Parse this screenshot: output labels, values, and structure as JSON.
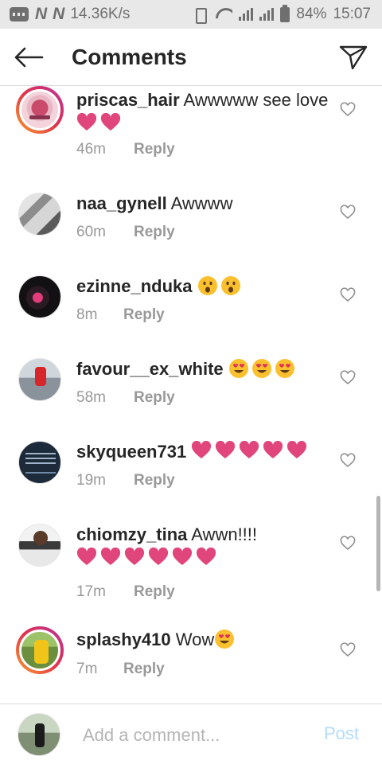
{
  "status_bar": {
    "network_letters": [
      "N",
      "N"
    ],
    "speed": "14.36K/s",
    "battery": "84%",
    "time": "15:07"
  },
  "header": {
    "title": "Comments",
    "back_icon": "arrow-left-icon",
    "send_icon": "paper-plane-icon"
  },
  "comments": [
    {
      "username": "priscas_hair",
      "text": "Awwwww see love",
      "time": "46m",
      "reply": "Reply",
      "emoji": [
        "pink-heart",
        "pink-heart"
      ]
    },
    {
      "username": "naa_gynell",
      "text": "Awwww",
      "time": "60m",
      "reply": "Reply",
      "emoji": []
    },
    {
      "username": "ezinne_nduka",
      "text": "",
      "time": "8m",
      "reply": "Reply",
      "emoji": [
        "hushed-face",
        "hushed-face"
      ]
    },
    {
      "username": "favour__ex_white",
      "text": "",
      "time": "58m",
      "reply": "Reply",
      "emoji": [
        "heart-eyes-face",
        "heart-eyes-face",
        "heart-eyes-face"
      ]
    },
    {
      "username": "skyqueen731",
      "text": "",
      "time": "19m",
      "reply": "Reply",
      "emoji": [
        "pink-heart",
        "pink-heart",
        "pink-heart",
        "pink-heart",
        "pink-heart"
      ]
    },
    {
      "username": "chiomzy_tina",
      "text": "Awwn!!!!",
      "time": "17m",
      "reply": "Reply",
      "emoji": [
        "pink-heart",
        "pink-heart",
        "pink-heart",
        "pink-heart",
        "pink-heart",
        "pink-heart"
      ]
    },
    {
      "username": "splashy410",
      "text": "Wow",
      "time": "7m",
      "reply": "Reply",
      "emoji": [
        "heart-eyes-face"
      ]
    }
  ],
  "composer": {
    "placeholder": "Add a comment...",
    "post_label": "Post"
  },
  "colors": {
    "pink_heart": "#e0467c",
    "post_disabled": "#b3dbff",
    "meta_grey": "#999999",
    "story_ring_start": "#f9a12e",
    "story_ring_end": "#b8329c"
  }
}
